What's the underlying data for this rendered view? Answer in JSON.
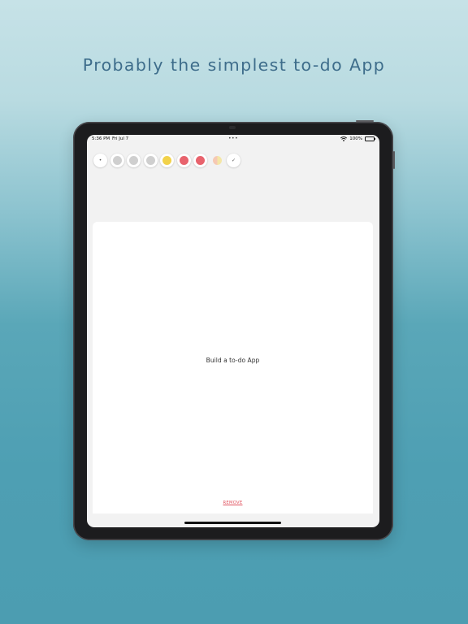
{
  "headline": "Probably the simplest to-do App",
  "status_bar": {
    "time": "5:36 PM",
    "date": "Fri Jul 7",
    "dots": "•••",
    "battery": "100%"
  },
  "color_picker": {
    "start_label": "•",
    "end_label": "✓",
    "swatches": [
      {
        "name": "gray-1",
        "color": "#cfcfcf"
      },
      {
        "name": "gray-2",
        "color": "#cfcfcf"
      },
      {
        "name": "gray-3",
        "color": "#cfcfcf"
      },
      {
        "name": "yellow",
        "color": "#f2d24a"
      },
      {
        "name": "red-1",
        "color": "#e8636d"
      },
      {
        "name": "red-2",
        "color": "#e8636d"
      }
    ]
  },
  "task": {
    "text": "Build a to-do App",
    "remove_label": "REMOVE"
  }
}
